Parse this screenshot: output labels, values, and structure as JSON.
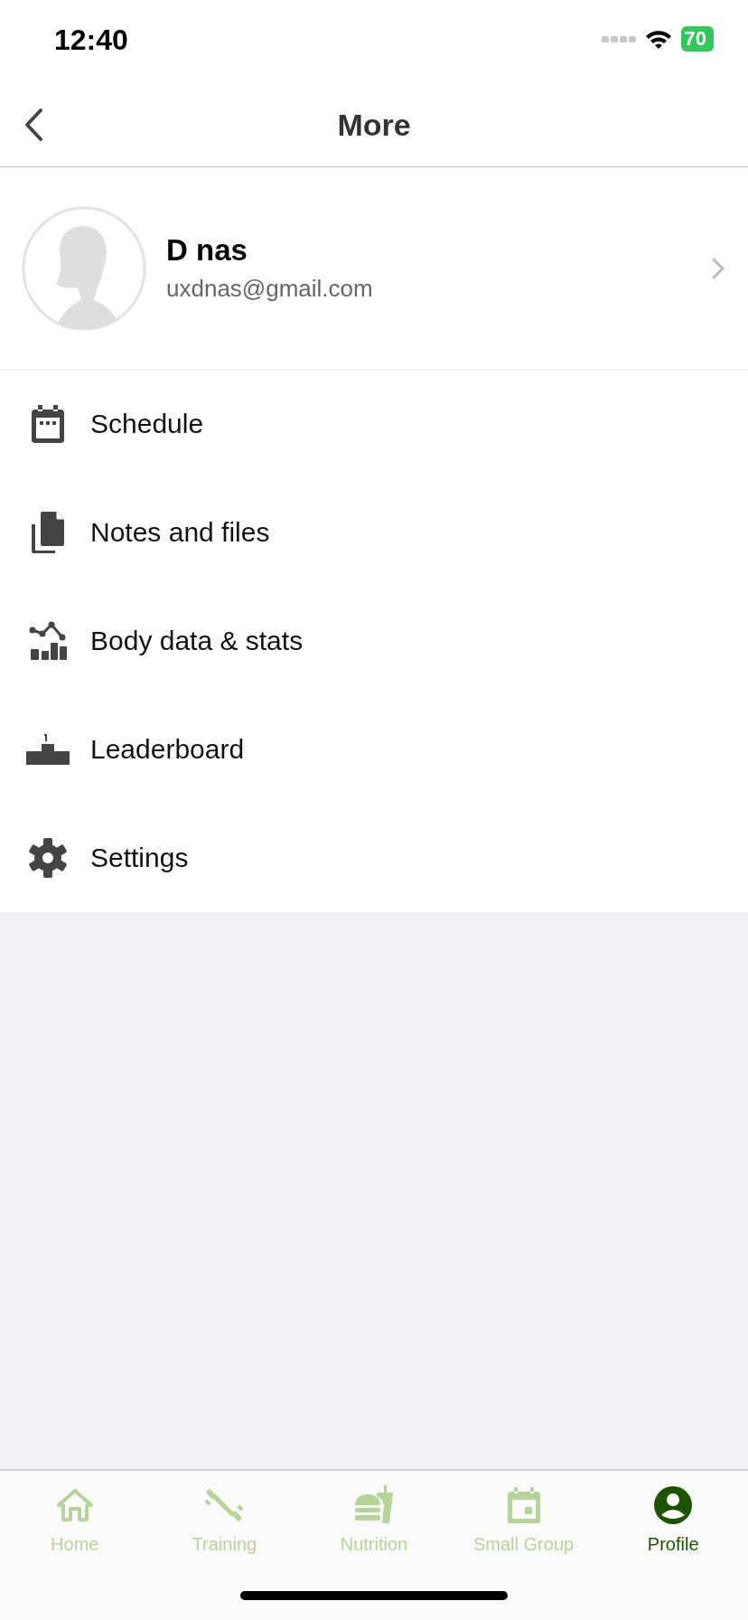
{
  "status_bar": {
    "time": "12:40",
    "battery": "70"
  },
  "header": {
    "title": "More"
  },
  "profile": {
    "name": "D nas",
    "email": "uxdnas@gmail.com"
  },
  "menu": [
    {
      "label": "Schedule"
    },
    {
      "label": "Notes and files"
    },
    {
      "label": "Body data & stats"
    },
    {
      "label": "Leaderboard"
    },
    {
      "label": "Settings"
    }
  ],
  "tabs": [
    {
      "label": "Home",
      "selected": false
    },
    {
      "label": "Training",
      "selected": false
    },
    {
      "label": "Nutrition",
      "selected": false
    },
    {
      "label": "Small Group",
      "selected": false
    },
    {
      "label": "Profile",
      "selected": true
    }
  ]
}
